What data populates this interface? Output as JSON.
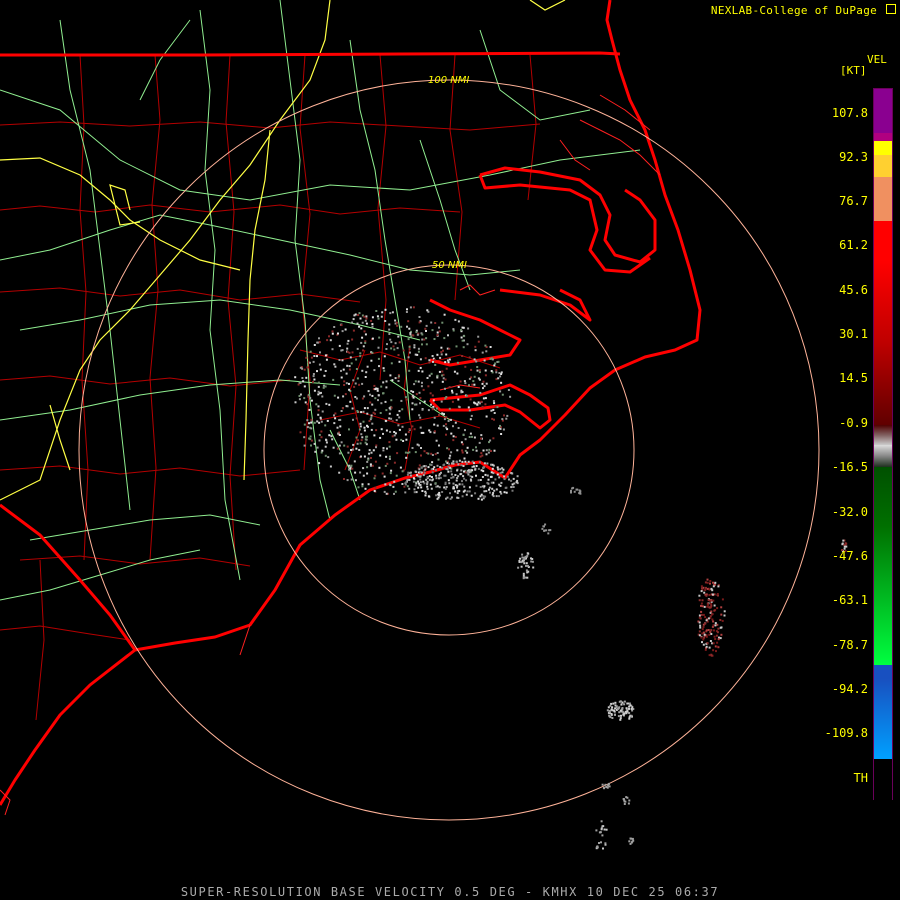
{
  "credit": "NEXLAB-College of DuPage",
  "footer": "SUPER-RESOLUTION BASE VELOCITY 0.5 DEG - KMHX 10 DEC 25 06:37",
  "legend": {
    "product": "VEL",
    "units": "[KT]",
    "ticks": [
      "107.8",
      "92.3",
      "76.7",
      "61.2",
      "45.6",
      "30.1",
      "14.5",
      "-0.9",
      "-16.5",
      "-32.0",
      "-47.6",
      "-63.1",
      "-78.7",
      "-94.2",
      "-109.8",
      "TH"
    ]
  },
  "range_rings": [
    {
      "label": "50 NMI"
    },
    {
      "label": "100 NMI"
    }
  ],
  "colors": {
    "coast": "#ff0000",
    "county": "#b40000",
    "highway": "#90ee90",
    "interstate": "#ffff44",
    "ring": "#ffb399",
    "label": "#ffff00",
    "echo_gray": "#c8c8c8",
    "echo_red": "#8b2a2a"
  },
  "map": {
    "radar_site": "KMHX",
    "layers": [
      "state-borders",
      "coastline",
      "county-lines",
      "highways",
      "interstates",
      "range-rings",
      "velocity-echoes"
    ]
  }
}
